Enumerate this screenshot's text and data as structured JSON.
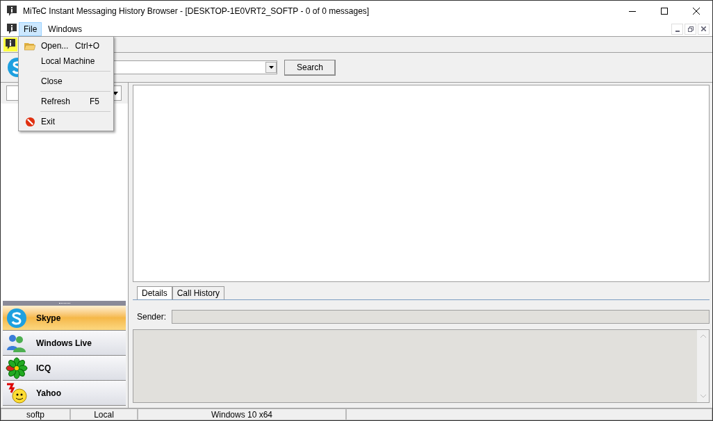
{
  "window": {
    "title": "MiTeC Instant Messaging History Browser - [DESKTOP-1E0VRT2_SOFTP - 0 of 0 messages]"
  },
  "menu_bar": [
    {
      "label": "File",
      "selected": true
    },
    {
      "label": "Windows",
      "selected": false
    }
  ],
  "file_menu": [
    {
      "kind": "item",
      "label": "Open...",
      "shortcut": "Ctrl+O"
    },
    {
      "kind": "item",
      "label": "Local Machine"
    },
    {
      "kind": "separator"
    },
    {
      "kind": "item",
      "label": "Close"
    },
    {
      "kind": "separator"
    },
    {
      "kind": "item",
      "label": "Refresh",
      "shortcut": "F5"
    },
    {
      "kind": "separator"
    },
    {
      "kind": "item",
      "label": "Exit"
    }
  ],
  "search": {
    "button": "Search"
  },
  "tabs": [
    {
      "label": "Details",
      "selected": true
    },
    {
      "label": "Call History",
      "selected": false
    }
  ],
  "details": {
    "sender_label": "Sender:"
  },
  "services": [
    {
      "name": "Skype",
      "kind": "skype",
      "selected": true
    },
    {
      "name": "Windows Live",
      "kind": "people",
      "selected": false
    },
    {
      "name": "ICQ",
      "kind": "flower",
      "selected": false
    },
    {
      "name": "Yahoo",
      "kind": "yahoo",
      "selected": false
    }
  ],
  "status_bar": [
    "softp",
    "Local",
    "Windows 10 x64"
  ]
}
